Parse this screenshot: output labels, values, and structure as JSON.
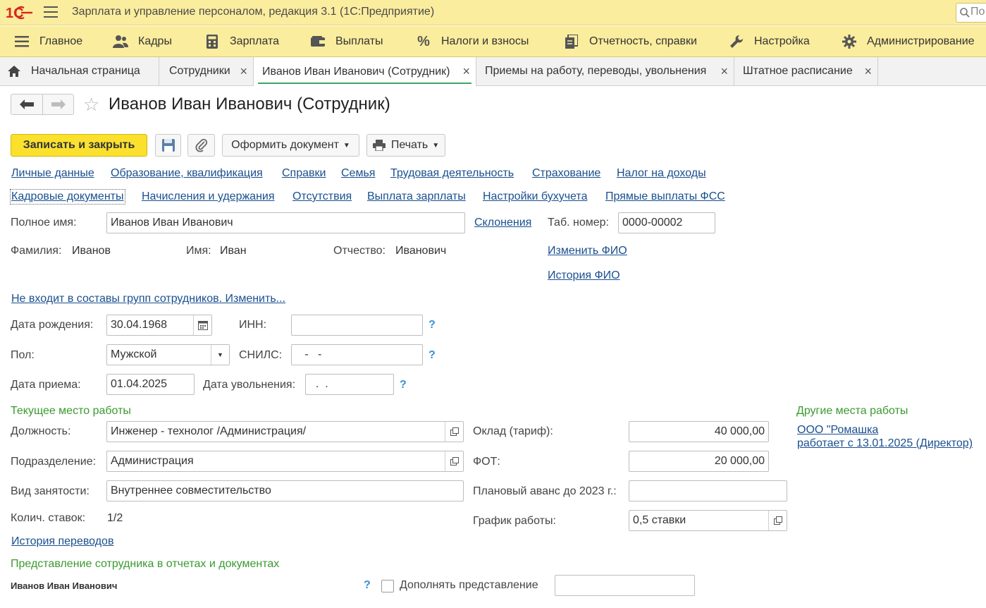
{
  "app": {
    "title": "Зарплата и управление персоналом, редакция 3.1  (1С:Предприятие)",
    "search_value": "По"
  },
  "sections": [
    {
      "label": "Главное",
      "icon": "list-icon"
    },
    {
      "label": "Кадры",
      "icon": "people-icon"
    },
    {
      "label": "Зарплата",
      "icon": "calculator-icon"
    },
    {
      "label": "Выплаты",
      "icon": "wallet-icon"
    },
    {
      "label": "Налоги и взносы",
      "icon": "percent-icon"
    },
    {
      "label": "Отчетность, справки",
      "icon": "reports-icon"
    },
    {
      "label": "Настройка",
      "icon": "wrench-icon"
    },
    {
      "label": "Администрирование",
      "icon": "gear-icon"
    }
  ],
  "tabs": [
    {
      "label": "Начальная страница"
    },
    {
      "label": "Сотрудники"
    },
    {
      "label": "Иванов Иван Иванович (Сотрудник)"
    },
    {
      "label": "Приемы на работу, переводы, увольнения"
    },
    {
      "label": "Штатное расписание"
    }
  ],
  "header": {
    "title": "Иванов Иван Иванович (Сотрудник)"
  },
  "toolbar": {
    "save_close": "Записать и закрыть",
    "create_doc": "Оформить документ",
    "print": "Печать"
  },
  "nav_links_row1": [
    "Личные данные",
    "Образование, квалификация",
    "Справки",
    "Семья",
    "Трудовая деятельность",
    "Страхование",
    "Налог на доходы"
  ],
  "nav_links_row2": [
    "Кадровые документы",
    "Начисления и удержания",
    "Отсутствия",
    "Выплата зарплаты",
    "Настройки бухучета",
    "Прямые выплаты ФСС"
  ],
  "person": {
    "full_name_label": "Полное имя:",
    "full_name": "Иванов Иван Иванович",
    "declensions_link": "Склонения",
    "tab_number_label": "Таб. номер:",
    "tab_number": "0000-00002",
    "last_name_label": "Фамилия:",
    "last_name": "Иванов",
    "first_name_label": "Имя:",
    "first_name": "Иван",
    "patronymic_label": "Отчество:",
    "patronymic": "Иванович",
    "change_name_link": "Изменить ФИО",
    "name_history_link": "История ФИО",
    "groups_link": "Не входит в составы групп сотрудников. Изменить...",
    "birth_date_label": "Дата рождения:",
    "birth_date": "30.04.1968",
    "inn_label": "ИНН:",
    "inn": "",
    "gender_label": "Пол:",
    "gender": "Мужской",
    "snils_label": "СНИЛС:",
    "snils": "   -   -",
    "hire_date_label": "Дата приема:",
    "hire_date": "01.04.2025",
    "dismissal_label": "Дата увольнения:",
    "dismissal_date": "  .  ."
  },
  "work": {
    "group_title": "Текущее место работы",
    "position_label": "Должность:",
    "position": "Инженер - технолог /Администрация/",
    "department_label": "Подразделение:",
    "department": "Администрация",
    "employment_label": "Вид занятости:",
    "employment": "Внутреннее совместительство",
    "rates_label": "Колич. ставок:",
    "rates": "1/2",
    "transfers_link": "История переводов",
    "salary_label": "Оклад (тариф):",
    "salary": "40 000,00",
    "fot_label": "ФОТ:",
    "fot": "20 000,00",
    "advance_label": "Плановый аванс до 2023 г.:",
    "advance": "",
    "schedule_label": "График работы:",
    "schedule": "0,5 ставки"
  },
  "other_work": {
    "group_title": "Другие места работы",
    "company": "ООО \"Ромашка",
    "since": "работает с 13.01.2025 (Директор)"
  },
  "representation": {
    "group_title": "Представление сотрудника в отчетах и документах",
    "value": "Иванов Иван Иванович",
    "complement_label": "Дополнять представление",
    "complement_value": ""
  },
  "colors": {
    "topbar": "#fbed9e",
    "primary_button": "#fbe12e",
    "link": "#1a4f8f",
    "group_title": "#3a9a2f",
    "tab_underline": "#3aa861"
  }
}
